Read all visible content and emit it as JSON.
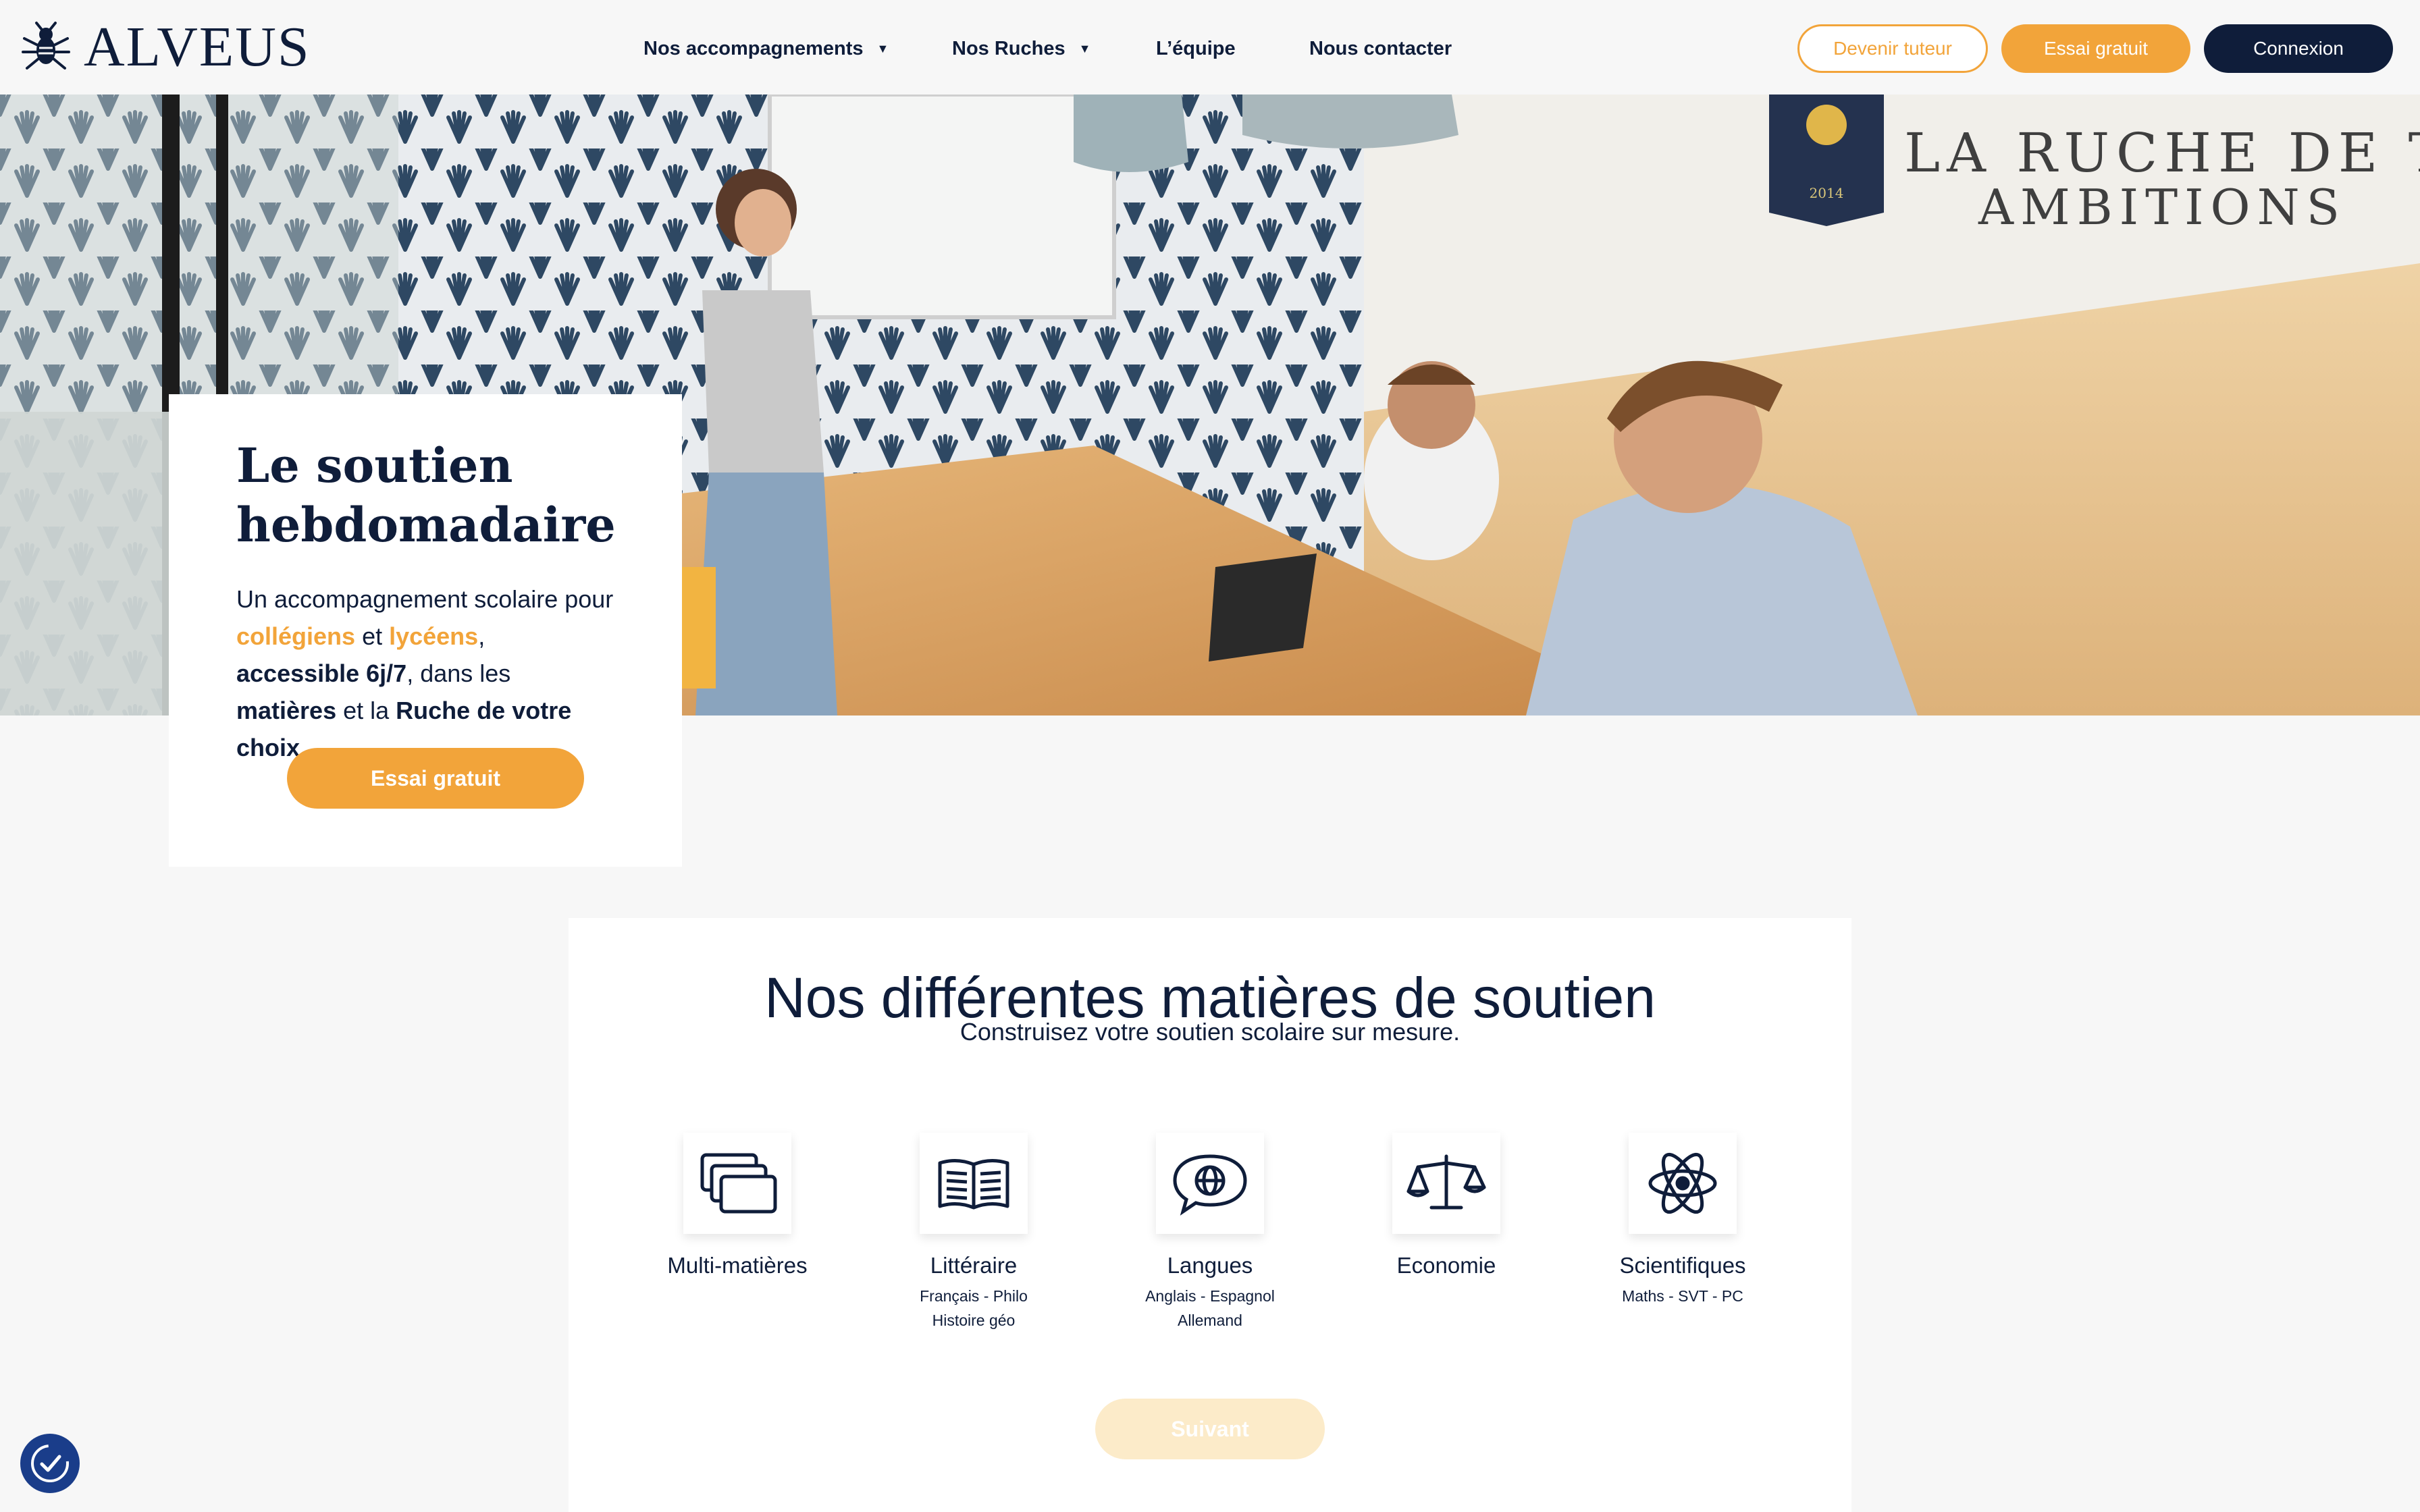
{
  "header": {
    "logo_text": "ALVEUS",
    "nav": [
      {
        "label": "Nos accompagnements",
        "has_caret": true
      },
      {
        "label": "Nos Ruches",
        "has_caret": true
      },
      {
        "label": "L’équipe",
        "has_caret": false
      },
      {
        "label": "Nous contacter",
        "has_caret": false
      }
    ],
    "caret_glyph": "▼",
    "buttons": {
      "become_tutor": "Devenir tuteur",
      "free_trial": "Essai gratuit",
      "login": "Connexion"
    }
  },
  "hero": {
    "wall_sign_line1": "LA RUCHE DE TES",
    "wall_sign_line2": "AMBITIONS",
    "badge_year": "2014",
    "title_line1": "Le soutien",
    "title_line2": "hebdomadaire",
    "desc": {
      "p1": "Un accompagnement scolaire pour ",
      "highlight1": "collégiens",
      "p2": " et ",
      "highlight2": "lycéens",
      "p3": ", ",
      "bold1": "accessible 6j/7",
      "p4": ", dans les ",
      "bold2": "matières",
      "p5": " et la ",
      "bold3": "Ruche de votre choix",
      "p6": "."
    },
    "cta": "Essai gratuit"
  },
  "subjects": {
    "title": "Nos différentes matières de soutien",
    "subtitle": "Construisez votre soutien scolaire sur mesure.",
    "items": [
      {
        "name": "Multi-matières",
        "detail1": "",
        "detail2": "",
        "icon": "stacked-cards-icon"
      },
      {
        "name": "Littéraire",
        "detail1": "Français - Philo",
        "detail2": "Histoire géo",
        "icon": "open-book-icon"
      },
      {
        "name": "Langues",
        "detail1": "Anglais - Espagnol",
        "detail2": "Allemand",
        "icon": "speech-globe-icon"
      },
      {
        "name": "Economie",
        "detail1": "",
        "detail2": "",
        "icon": "scales-icon"
      },
      {
        "name": "Scientifiques",
        "detail1": "Maths - SVT - PC",
        "detail2": "",
        "icon": "atom-icon"
      }
    ],
    "next_button": "Suivant"
  },
  "colors": {
    "navy": "#0f1d3a",
    "orange": "#f2a43a",
    "orange_disabled": "#fcebc9",
    "background": "#f7f7f7"
  }
}
